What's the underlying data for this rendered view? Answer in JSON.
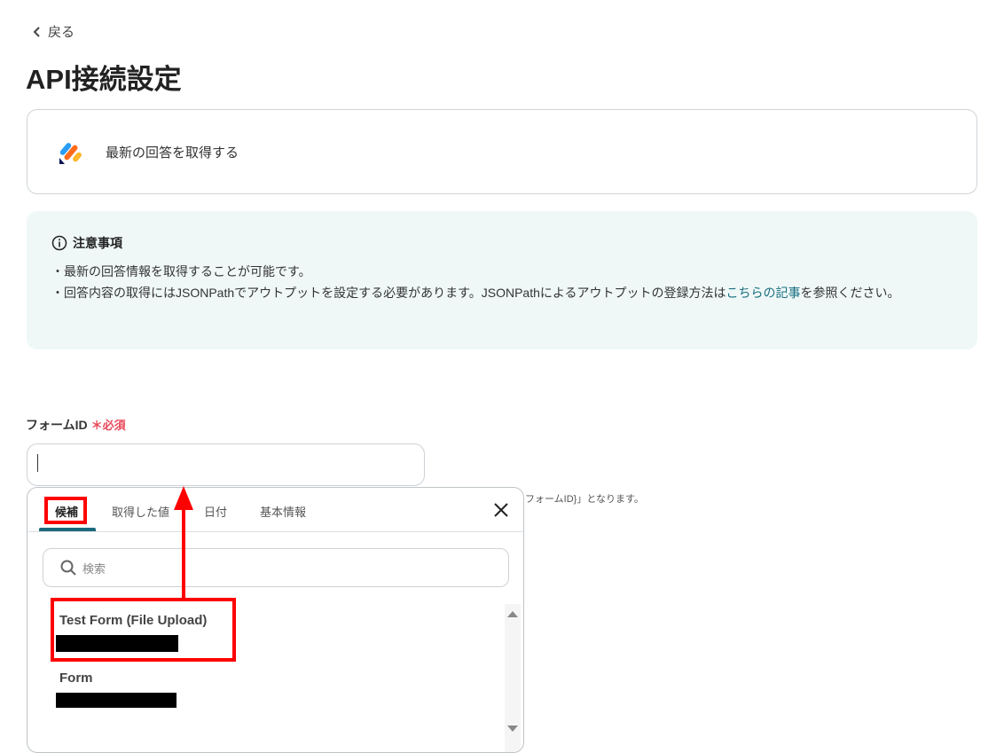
{
  "nav": {
    "back_label": "戻る"
  },
  "page": {
    "title": "API接続設定"
  },
  "action_card": {
    "label": "最新の回答を取得する",
    "icon": "jotform-logo"
  },
  "notice": {
    "heading": "注意事項",
    "line1": "・最新の回答情報を取得することが可能です。",
    "line2_pre": "・回答内容の取得にはJSONPathでアウトプットを設定する必要があります。JSONPathによるアウトプットの登録方法は",
    "line2_link": "こちらの記事",
    "line2_post": "を参照ください。"
  },
  "field": {
    "label": "フォームID",
    "required": "必須",
    "value": "",
    "hint": "フォームID}」となります。"
  },
  "popup": {
    "tabs": [
      "候補",
      "取得した値",
      "日付",
      "基本情報"
    ],
    "active_tab": "候補",
    "search_placeholder": "検索",
    "items": [
      {
        "name": "Test Form (File Upload)"
      },
      {
        "name": "Form"
      }
    ]
  },
  "colors": {
    "accent": "#1b6a7c",
    "required": "#e8485a",
    "annotation": "#ff0000"
  }
}
